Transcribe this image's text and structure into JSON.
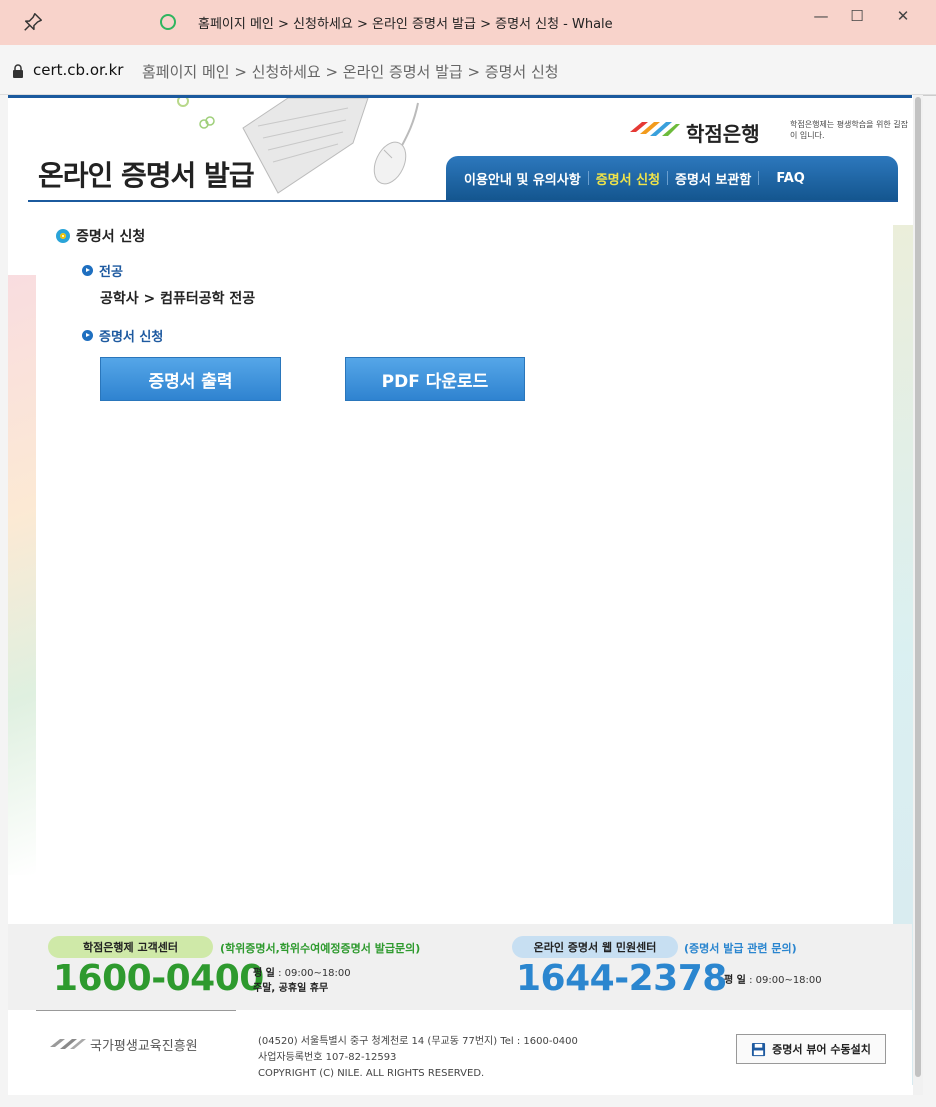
{
  "window": {
    "title": "홈페이지 메인 > 신청하세요 > 온라인 증명서 발급 > 증명서 신청 - Whale",
    "minimize": "—",
    "maximize": "☐",
    "close": "✕"
  },
  "address": {
    "domain": "cert.cb.or.kr",
    "path": "홈페이지 메인 > 신청하세요 > 온라인 증명서 발급 > 증명서 신청"
  },
  "header": {
    "title": "온라인 증명서 발급",
    "logo_text": "학점은행",
    "logo_slogan": "학점은행제는 평생학습을 위한 길잡이 입니다."
  },
  "nav": {
    "items": [
      {
        "label": "이용안내 및 유의사항",
        "active": false
      },
      {
        "label": "증명서 신청",
        "active": true
      },
      {
        "label": "증명서 보관함",
        "active": false
      },
      {
        "label": "FAQ",
        "active": false
      }
    ]
  },
  "main": {
    "section_title": "증명서 신청",
    "major_label": "전공",
    "major_value": "공학사 > 컴퓨터공학 전공",
    "apply_label": "증명서 신청",
    "print_button": "증명서 출력",
    "pdf_button": "PDF 다운로드"
  },
  "call_center": {
    "left": {
      "pill": "학점은행제 고객센터",
      "note": "(학위증명서,학위수여예정증명서 발급문의)",
      "phone": "1600-0400",
      "hours_line1_label": "평   일",
      "hours_line1_value": ": 09:00~18:00",
      "hours_line2": "주말, 공휴일 휴무"
    },
    "right": {
      "pill": "온라인 증명서 웹 민원센터",
      "note": "(증명서 발급 관련 문의)",
      "phone": "1644-2378",
      "hours_label": "평   일",
      "hours_value": ": 09:00~18:00"
    }
  },
  "footer": {
    "org_name": "국가평생교육진흥원",
    "address_line1": "(04520) 서울특별시 중구 청계천로 14 (무교동 77번지)   Tel : 1600-0400",
    "address_line2": "사업자등록번호 107-82-12593",
    "copyright": "COPYRIGHT (C) NILE. ALL RIGHTS RESERVED.",
    "viewer_button": "증명서 뷰어 수동설치"
  },
  "colors": {
    "nav_bg": "#1b5a9e",
    "nav_active": "#f0e44a",
    "phone_green": "#2e9a2e",
    "phone_blue": "#2b86cf",
    "titlebar": "#f8d3cb"
  }
}
